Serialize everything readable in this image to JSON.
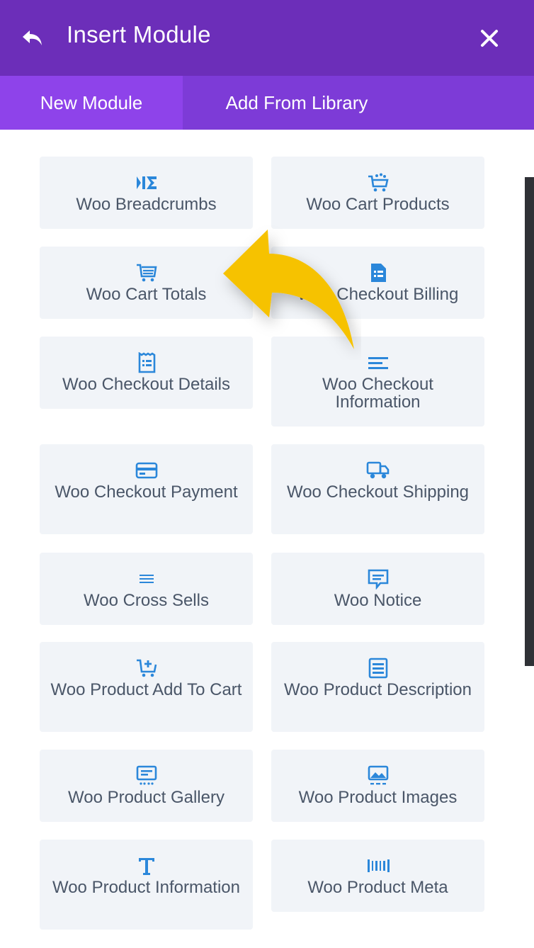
{
  "header": {
    "title": "Insert Module",
    "back_icon": "undo-arrow-icon",
    "close_icon": "close-icon"
  },
  "tabs": [
    {
      "label": "New Module",
      "active": true
    },
    {
      "label": "Add From Library",
      "active": false
    }
  ],
  "colors": {
    "header_bg": "#6c2eb9",
    "tab_bar": "#7d3bd7",
    "active_tab": "#8e43ea",
    "icon": "#2b87da",
    "module_bg": "#f1f4f8",
    "label": "#4a5668",
    "arrow": "#f6c200"
  },
  "modules": [
    {
      "label": "Woo Breadcrumbs",
      "icon": "breadcrumbs-icon"
    },
    {
      "label": "Woo Cart Products",
      "icon": "cart-products-icon"
    },
    {
      "label": "Woo Cart Totals",
      "icon": "cart-totals-icon"
    },
    {
      "label": "Woo Checkout Billing",
      "icon": "document-icon"
    },
    {
      "label": "Woo Checkout Details",
      "icon": "receipt-icon"
    },
    {
      "label": "Woo Checkout Information",
      "icon": "text-lines-icon"
    },
    {
      "label": "Woo Checkout Payment",
      "icon": "credit-card-icon"
    },
    {
      "label": "Woo Checkout Shipping",
      "icon": "truck-icon"
    },
    {
      "label": "Woo Cross Sells",
      "icon": "list-lines-icon"
    },
    {
      "label": "Woo Notice",
      "icon": "message-icon"
    },
    {
      "label": "Woo Product Add To Cart",
      "icon": "cart-plus-icon"
    },
    {
      "label": "Woo Product Description",
      "icon": "description-icon"
    },
    {
      "label": "Woo Product Gallery",
      "icon": "gallery-icon"
    },
    {
      "label": "Woo Product Images",
      "icon": "image-icon"
    },
    {
      "label": "Woo Product Information",
      "icon": "text-t-icon"
    },
    {
      "label": "Woo Product Meta",
      "icon": "barcode-icon"
    }
  ]
}
